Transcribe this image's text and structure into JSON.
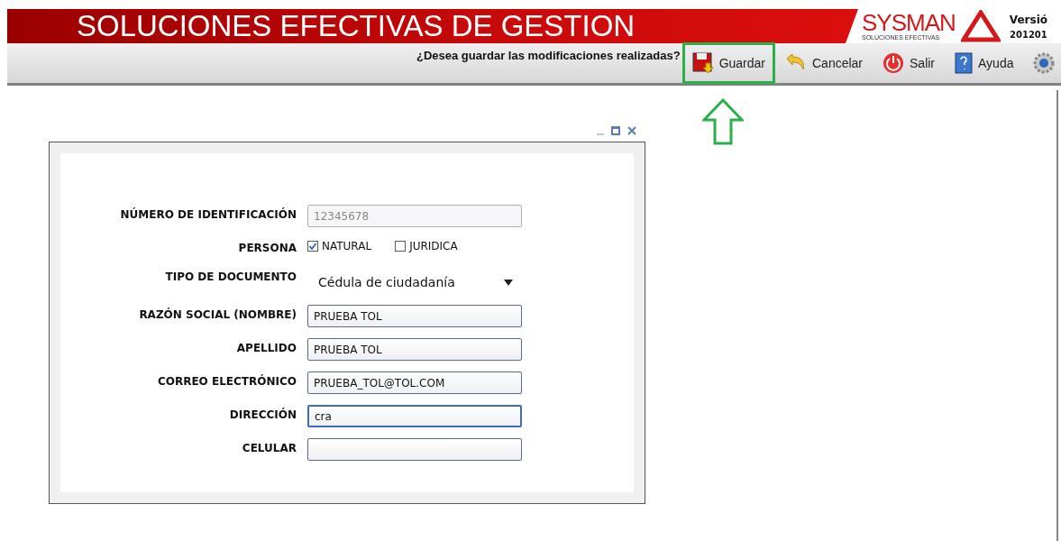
{
  "header": {
    "title": "SOLUCIONES EFECTIVAS DE GESTION",
    "logo_text": "SYSMAN",
    "logo_tagline": "SOLUCIONES EFECTIVAS",
    "version_label": "Versió",
    "version_number": "201201"
  },
  "toolbar": {
    "message": "¿Desea guardar las modificaciones realizadas?",
    "buttons": [
      {
        "kind": "save",
        "label": "Guardar",
        "highlighted": true
      },
      {
        "kind": "undo",
        "label": "Cancelar",
        "highlighted": false
      },
      {
        "kind": "power",
        "label": "Salir",
        "highlighted": false
      },
      {
        "kind": "help",
        "label": "Ayuda",
        "highlighted": false
      },
      {
        "kind": "gear",
        "highlighted": false
      }
    ]
  },
  "form": {
    "fields": [
      {
        "kind": "text",
        "label": "NÚMERO DE IDENTIFICACIÓN",
        "value": "12345678",
        "disabled": true,
        "focused": false
      },
      {
        "kind": "checkboxes",
        "label": "PERSONA",
        "options": [
          {
            "label": "NATURAL",
            "checked": true
          },
          {
            "label": "JURIDICA",
            "checked": false
          }
        ]
      },
      {
        "kind": "select",
        "label": "TIPO DE DOCUMENTO",
        "value": "Cédula de ciudadanía"
      },
      {
        "kind": "text",
        "label": "RAZÓN SOCIAL (NOMBRE)",
        "value": "PRUEBA TOL",
        "disabled": false,
        "focused": false
      },
      {
        "kind": "text",
        "label": "APELLIDO",
        "value": "PRUEBA TOL",
        "disabled": false,
        "focused": false
      },
      {
        "kind": "text",
        "label": "CORREO ELECTRÓNICO",
        "value": "PRUEBA_TOL@TOL.COM",
        "disabled": false,
        "focused": false
      },
      {
        "kind": "text",
        "label": "DIRECCIÓN",
        "value": "cra",
        "disabled": false,
        "focused": true
      },
      {
        "kind": "text",
        "label": "CELULAR",
        "disabled": false,
        "focused": false
      }
    ]
  }
}
